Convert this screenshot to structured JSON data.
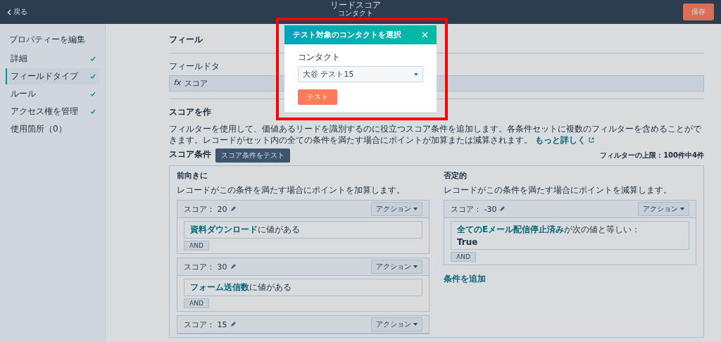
{
  "header": {
    "back": "戻る",
    "title": "リードスコア",
    "subtitle": "コンタクト",
    "save": "保存"
  },
  "sidebar": {
    "title": "プロパティーを編集",
    "items": [
      {
        "label": "詳細",
        "selected": false,
        "checked": true
      },
      {
        "label": "フィールドタイプ",
        "selected": true,
        "checked": true
      },
      {
        "label": "ルール",
        "selected": false,
        "checked": true
      },
      {
        "label": "アクセス権を管理",
        "selected": false,
        "checked": true
      },
      {
        "label": "使用箇所（0）",
        "selected": false,
        "checked": false
      }
    ]
  },
  "main": {
    "section_1_heading": "フィール",
    "field_label": "フィールドタ",
    "field_icon": "fx",
    "field_value": "スコア",
    "section_2_heading": "スコアを作",
    "description": "フィルターを使用して、価値あるリードを識別するのに役立つスコア条件を追加します。各条件セットに複数のフィルターを含めることができます。レコードがセット内の全ての条件を満たす場合にポイントが加算または減算されます。",
    "learn_more": "もっと詳しく",
    "criteria_label": "スコア条件",
    "test_button": "スコア条件をテスト",
    "filter_limit": "フィルターの上限：100件中4件",
    "columns": [
      {
        "heading": "前向きに",
        "description": "レコードがこの条件を満たす場合にポイントを加算します。",
        "cards": [
          {
            "score": "スコア：  20",
            "action": "アクション",
            "property": "資料ダウンロード",
            "condition": "に値がある",
            "and": "AND"
          },
          {
            "score": "スコア：  30",
            "action": "アクション",
            "property": "フォーム送信数",
            "condition": "に値がある",
            "and": "AND"
          },
          {
            "score": "スコア：  15",
            "action": "アクション"
          }
        ]
      },
      {
        "heading": "否定的",
        "description": "レコードがこの条件を満たす場合にポイントを減算します。",
        "cards": [
          {
            "score": "スコア：  -30",
            "action": "アクション",
            "property": "全てのEメール配信停止済み",
            "condition": "が次の値と等しい：",
            "value": "True",
            "and": "AND"
          }
        ],
        "add_link": "条件を追加"
      }
    ]
  },
  "modal": {
    "title": "テスト対象のコンタクトを選択",
    "field_label": "コンタクト",
    "field_value": "大谷 テスト15",
    "button": "テスト"
  }
}
